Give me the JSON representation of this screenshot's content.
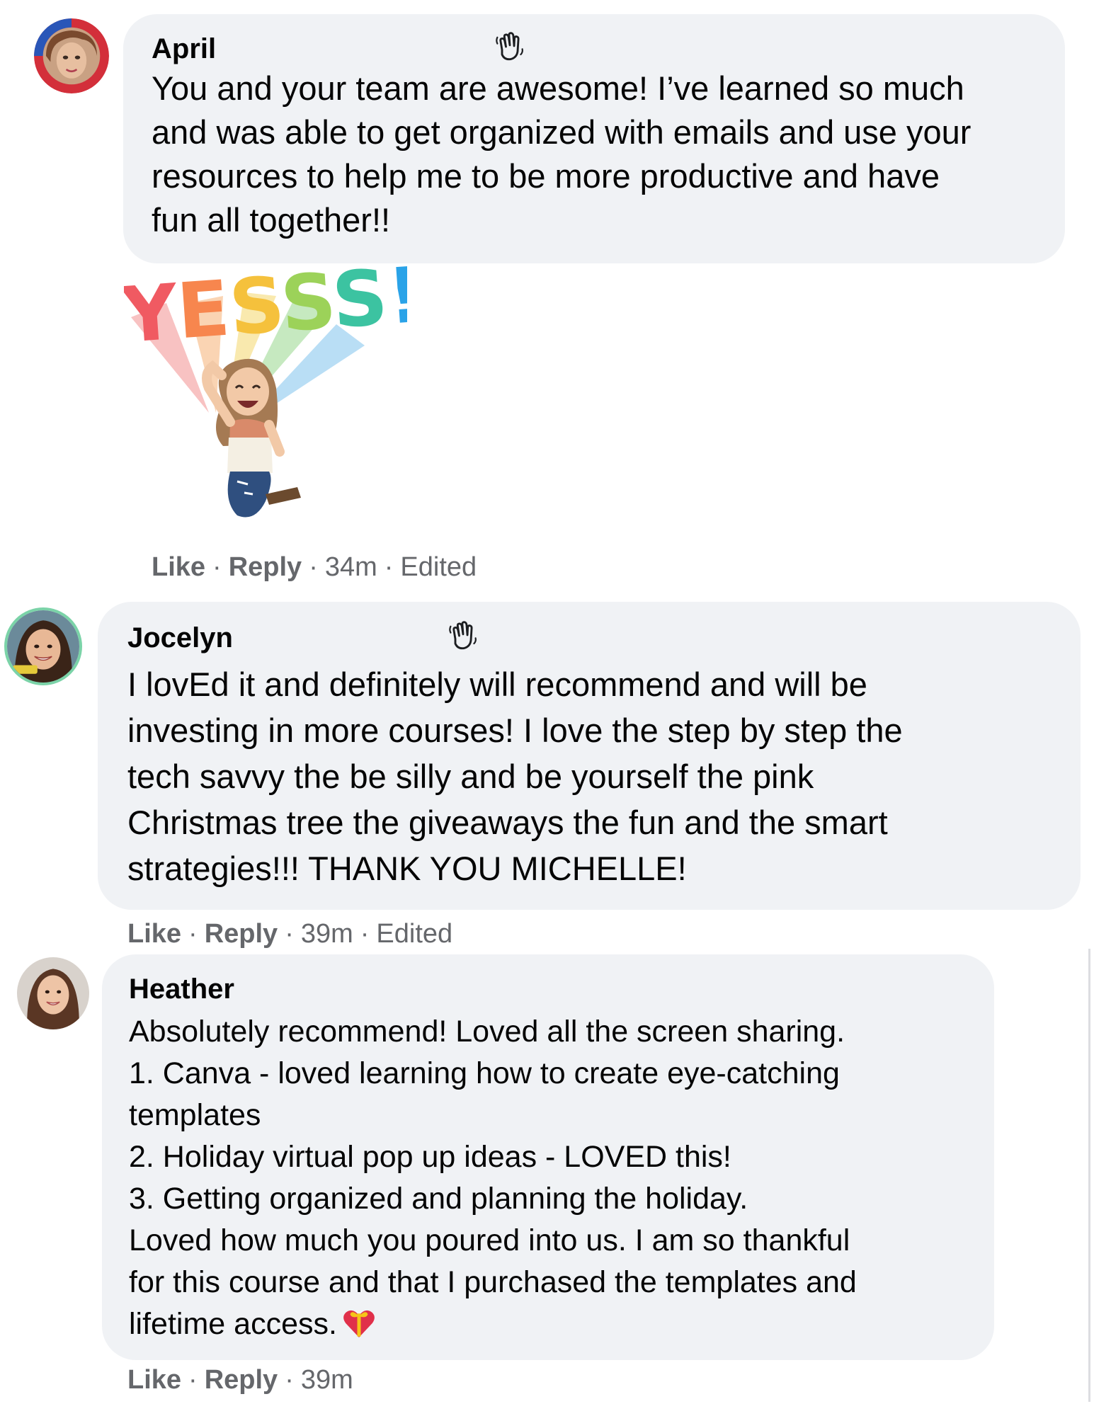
{
  "comments": [
    {
      "author": "April",
      "text_lines": [
        "You and your team are awesome! I’ve learned so much",
        "and was able to get organized with emails and use your",
        "resources to help me to be more productive and have",
        "fun all together!!"
      ],
      "sticker_text": "YESSS!",
      "actions": {
        "like": "Like",
        "reply": "Reply",
        "time": "34m",
        "edited": "Edited"
      }
    },
    {
      "author": "Jocelyn",
      "text_lines": [
        "I lovEd it and definitely will recommend and will be",
        "investing in more courses! I love the step by step the",
        "tech savvy the be silly and be yourself the pink",
        "Christmas tree the giveaways the fun and the smart",
        "strategies!!! THANK YOU MICHELLE!"
      ],
      "actions": {
        "like": "Like",
        "reply": "Reply",
        "time": "39m",
        "edited": "Edited"
      }
    },
    {
      "author": "Heather",
      "text_lines": [
        "Absolutely recommend! Loved all the screen sharing.",
        "1. Canva - loved learning how to create eye-catching",
        "templates",
        "2. Holiday virtual pop up ideas - LOVED this!",
        "3. Getting organized and planning the holiday.",
        "Loved how much you poured into us. I am so thankful",
        "for this course and that I purchased the templates and",
        "lifetime access."
      ],
      "actions": {
        "like": "Like",
        "reply": "Reply",
        "time": "39m"
      }
    }
  ],
  "separator": "·",
  "colors": {
    "bubble": "#f0f2f5",
    "text": "#050505",
    "meta": "#65676b"
  },
  "icons": {
    "wave": "waving-hand-icon",
    "heart": "heart-with-ribbon-icon"
  }
}
